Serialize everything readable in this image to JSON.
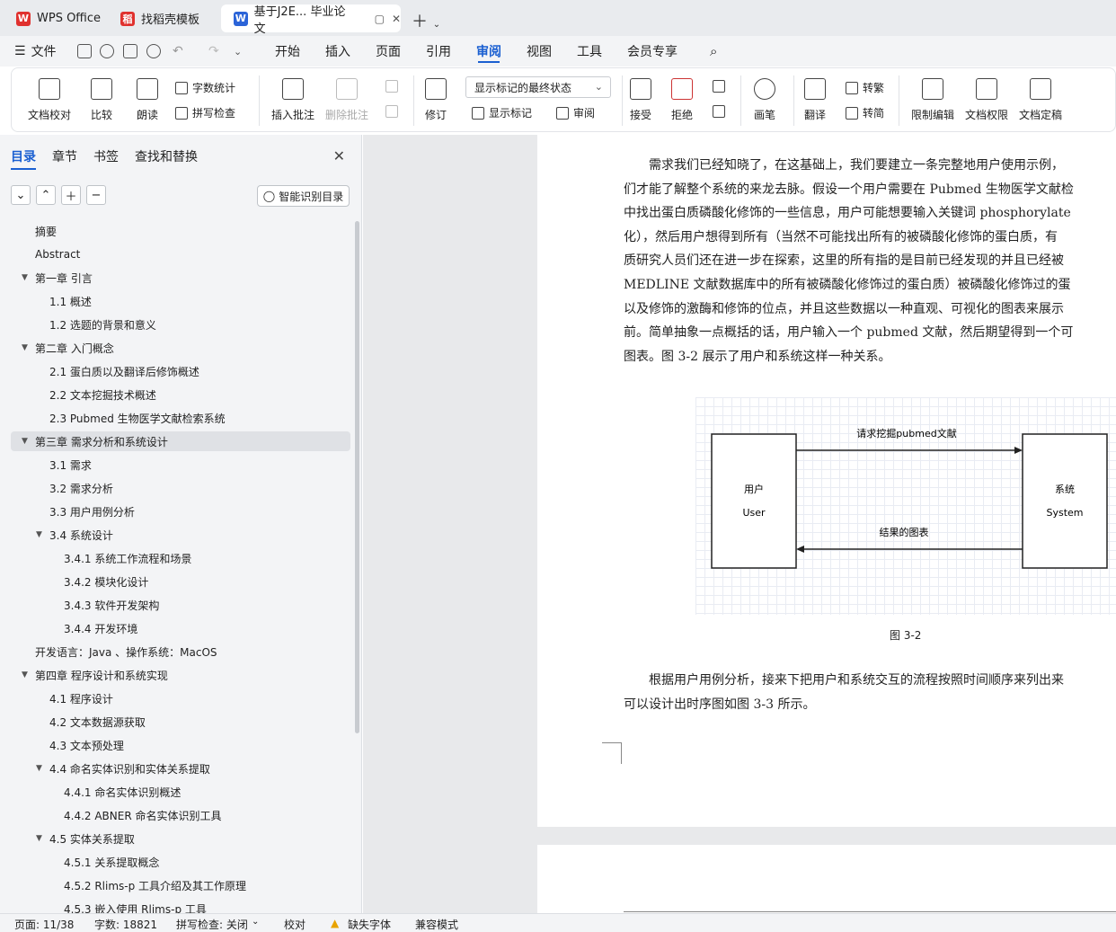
{
  "tabs": [
    {
      "label": "WPS Office",
      "icon": "W"
    },
    {
      "label": "找稻壳模板",
      "icon": "稻"
    },
    {
      "label": "基于J2E... 毕业论文",
      "icon": "W"
    }
  ],
  "menu": {
    "file": "文件",
    "items": [
      "开始",
      "插入",
      "页面",
      "引用",
      "审阅",
      "视图",
      "工具",
      "会员专享"
    ],
    "active": "审阅"
  },
  "ribbon": {
    "doc_check": "文档校对",
    "compare": "比较",
    "read_aloud": "朗读",
    "word_count": "字数统计",
    "spell_check": "拼写检查",
    "insert_comment": "插入批注",
    "delete_comment": "删除批注",
    "revise": "修订",
    "markup_dropdown": "显示标记的最终状态",
    "show_markup": "显示标记",
    "review": "审阅",
    "accept": "接受",
    "reject": "拒绝",
    "pen": "画笔",
    "translate": "翻译",
    "to_traditional": "转繁",
    "to_simplified": "转简",
    "restrict_edit": "限制编辑",
    "doc_permission": "文档权限",
    "doc_finalize": "文档定稿"
  },
  "sidebar": {
    "tabs": [
      "目录",
      "章节",
      "书签",
      "查找和替换"
    ],
    "smart_toc": "智能识别目录",
    "items": [
      {
        "label": "摘要",
        "level": 1
      },
      {
        "label": "Abstract",
        "level": 1
      },
      {
        "label": "第一章  引言",
        "level": 1,
        "expand": true
      },
      {
        "label": "1.1  概述",
        "level": 2
      },
      {
        "label": "1.2  选题的背景和意义",
        "level": 2
      },
      {
        "label": "第二章  入门概念",
        "level": 1,
        "expand": true
      },
      {
        "label": "2.1  蛋白质以及翻译后修饰概述",
        "level": 2
      },
      {
        "label": "2.2 文本挖掘技术概述",
        "level": 2
      },
      {
        "label": "2.3 Pubmed 生物医学文献检索系统",
        "level": 2
      },
      {
        "label": "第三章  需求分析和系统设计",
        "level": 1,
        "expand": true,
        "selected": true
      },
      {
        "label": "3.1 需求",
        "level": 2
      },
      {
        "label": "3.2  需求分析",
        "level": 2
      },
      {
        "label": "3.3  用户用例分析",
        "level": 2
      },
      {
        "label": "3.4  系统设计",
        "level": 2,
        "expand": true
      },
      {
        "label": "3.4.1  系统工作流程和场景",
        "level": 3
      },
      {
        "label": "3.4.2  模块化设计",
        "level": 3
      },
      {
        "label": "3.4.3  软件开发架构",
        "level": 3
      },
      {
        "label": "3.4.4  开发环境",
        "level": 3
      },
      {
        "label": "开发语言：Java  、操作系统：MacOS",
        "level": 1
      },
      {
        "label": "第四章  程序设计和系统实现",
        "level": 1,
        "expand": true
      },
      {
        "label": "4.1  程序设计",
        "level": 2
      },
      {
        "label": "4.2  文本数据源获取",
        "level": 2
      },
      {
        "label": "4.3  文本预处理",
        "level": 2
      },
      {
        "label": "4.4  命名实体识别和实体关系提取",
        "level": 2,
        "expand": true
      },
      {
        "label": "4.4.1 命名实体识别概述",
        "level": 3
      },
      {
        "label": "4.4.2 ABNER 命名实体识别工具",
        "level": 3
      },
      {
        "label": "4.5  实体关系提取",
        "level": 2,
        "expand": true
      },
      {
        "label": "4.5.1  关系提取概念",
        "level": 3
      },
      {
        "label": "4.5.2 Rlims-p 工具介绍及其工作原理",
        "level": 3
      },
      {
        "label": "4.5.3  嵌入使用 Rlims-p 工具",
        "level": 3
      }
    ]
  },
  "document": {
    "para1": [
      "需求我们已经知晓了，在这基础上，我们要建立一条完整地用户使用示例，",
      "们才能了解整个系统的来龙去脉。假设一个用户需要在 Pubmed 生物医学文献检",
      "中找出蛋白质磷酸化修饰的一些信息，用户可能想要输入关键词 phosphorylate",
      "化），然后用户想得到所有（当然不可能找出所有的被磷酸化修饰的蛋白质，有",
      "质研究人员们还在进一步在探索，这里的所有指的是目前已经发现的并且已经被",
      "MEDLINE 文献数据库中的所有被磷酸化修饰过的蛋白质）被磷酸化修饰过的蛋",
      "以及修饰的激酶和修饰的位点，并且这些数据以一种直观、可视化的图表来展示",
      "前。简单抽象一点概括的话，用户输入一个 pubmed 文献，然后期望得到一个可",
      "图表。图 3-2 展示了用户和系统这样一种关系。"
    ],
    "figure": {
      "user_cn": "用户",
      "user_en": "User",
      "system_cn": "系统",
      "system_en": "System",
      "request": "请求挖掘pubmed文献",
      "result": "结果的图表"
    },
    "caption": "图 3-2",
    "para2": [
      "根据用户用例分析，接来下把用户和系统交互的流程按照时间顺序来列出来",
      "可以设计出时序图如图 3-3 所示。"
    ]
  },
  "status": {
    "page": "页面: 11/38",
    "words": "字数: 18821",
    "spell": "拼写检查: 关闭",
    "proof": "校对",
    "missing_font": "缺失字体",
    "compat": "兼容模式"
  }
}
